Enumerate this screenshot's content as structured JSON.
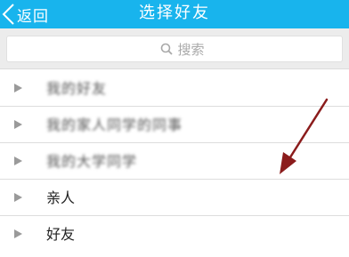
{
  "header": {
    "back_label": "返回",
    "title": "选择好友"
  },
  "search": {
    "placeholder": "搜索"
  },
  "groups": [
    {
      "label": "我的好友"
    },
    {
      "label": "我的家人同学的同事"
    },
    {
      "label": "我的大学同学"
    },
    {
      "label": "亲人"
    },
    {
      "label": "好友"
    }
  ],
  "colors": {
    "header": "#18b4ed",
    "annotation_arrow": "#8b1c1c"
  }
}
